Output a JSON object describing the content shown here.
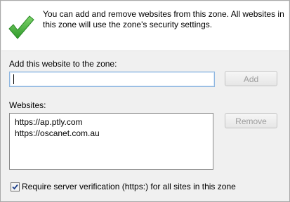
{
  "info": {
    "line1": "You can add and remove websites from this zone. All websites in",
    "line2": "this zone will use the zone's security settings."
  },
  "add_section": {
    "label": "Add this website to the zone:",
    "input_value": "",
    "add_button": "Add"
  },
  "websites": {
    "label": "Websites:",
    "items": [
      "https://ap.ptly.com",
      "https://oscanet.com.au"
    ],
    "remove_button": "Remove"
  },
  "https_requirement": {
    "checked": true,
    "label": "Require server verification (https:) for all sites in this zone"
  },
  "colors": {
    "check_green": "#3db43a",
    "disabled_text": "#9d9d9d"
  }
}
